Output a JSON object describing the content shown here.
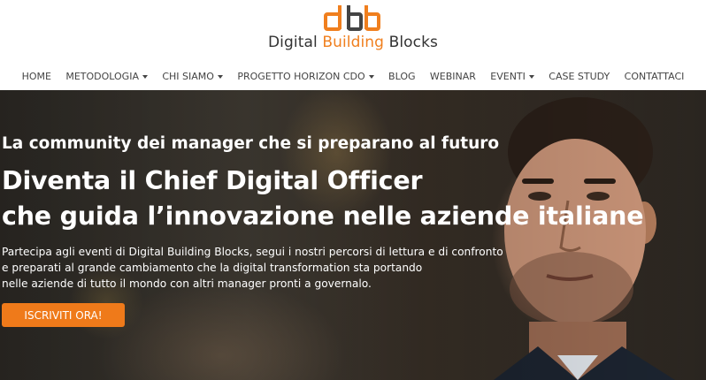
{
  "logo": {
    "mark_text": "dbb",
    "name_part1": "Digital ",
    "name_accent": "Building",
    "name_part2": " Blocks",
    "accent_color": "#f07f1e"
  },
  "nav": {
    "items": [
      {
        "label": "HOME",
        "dropdown": false
      },
      {
        "label": "METODOLOGIA",
        "dropdown": true
      },
      {
        "label": "CHI SIAMO",
        "dropdown": true
      },
      {
        "label": "PROGETTO HORIZON CDO",
        "dropdown": true
      },
      {
        "label": "BLOG",
        "dropdown": false
      },
      {
        "label": "WEBINAR",
        "dropdown": false
      },
      {
        "label": "EVENTI",
        "dropdown": true
      },
      {
        "label": "CASE STUDY",
        "dropdown": false
      },
      {
        "label": "CONTATTACI",
        "dropdown": false
      }
    ]
  },
  "hero": {
    "tagline": "La community dei manager che si preparano al futuro",
    "headline_prefix": "Diventa il ",
    "headline_bold": "Chief Digital Officer",
    "headline_line2": "che guida l’innovazione nelle aziende italiane",
    "description_lines": [
      "Partecipa agli eventi di Digital Building Blocks, segui i nostri percorsi di lettura e di confronto",
      "e preparati al grande cambiamento che la digital transformation sta portando",
      "nelle aziende di tutto il mondo con altri manager pronti a governalo."
    ],
    "cta_label": "ISCRIVITI ORA!",
    "cta_color": "#ef7a1a"
  }
}
